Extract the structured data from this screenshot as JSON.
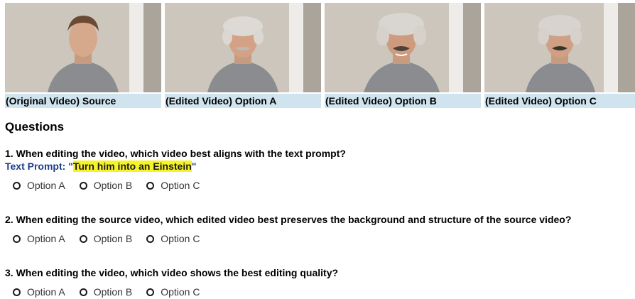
{
  "videos": [
    {
      "caption": "(Original Video) Source",
      "face": "young"
    },
    {
      "caption": "(Edited Video) Option A",
      "face": "einstein"
    },
    {
      "caption": "(Edited Video) Option B",
      "face": "einstein"
    },
    {
      "caption": "(Edited Video) Option C",
      "face": "einstein"
    }
  ],
  "questions_title": "Questions",
  "q1": {
    "text": "1. When editing the video, which video best aligns with the text prompt?",
    "prompt_label": "Text Prompt: \"",
    "prompt_value": "Turn him into an Einstein",
    "prompt_close": "\"",
    "options": [
      "Option A",
      "Option B",
      "Option C"
    ]
  },
  "q2": {
    "text": "2. When editing the source video, which edited video best preserves the background and structure of the source video?",
    "options": [
      "Option A",
      "Option B",
      "Option C"
    ]
  },
  "q3": {
    "text": "3. When editing the video, which video shows the best editing quality?",
    "options": [
      "Option A",
      "Option B",
      "Option C"
    ]
  },
  "colors": {
    "caption_bg": "#cfe4ee",
    "prompt_color": "#1f3f8a",
    "highlight": "#f6f32a"
  }
}
